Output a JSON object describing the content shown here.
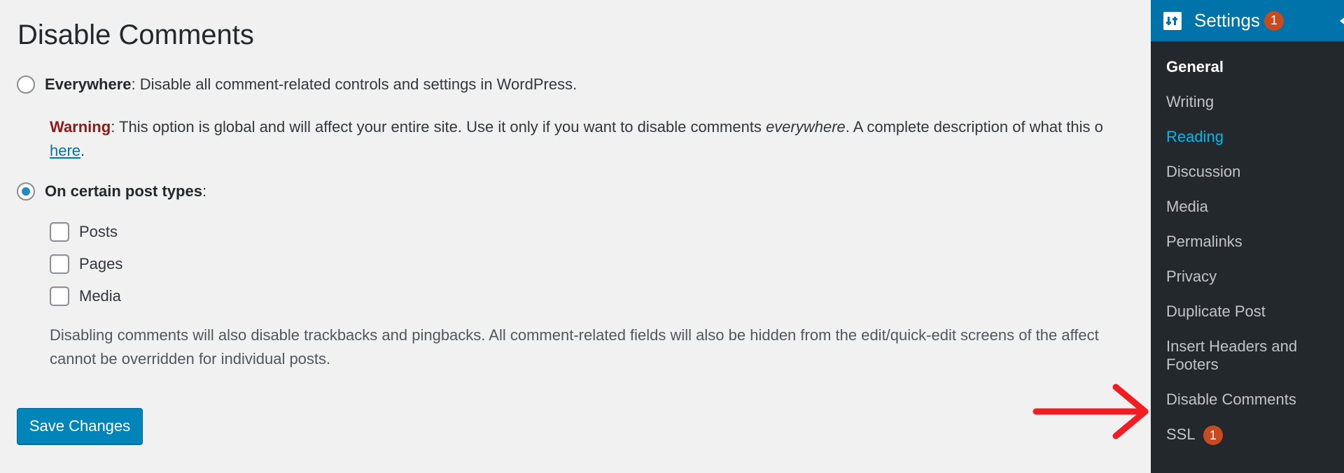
{
  "page": {
    "title": "Disable Comments"
  },
  "options": {
    "everywhere": {
      "label": "Everywhere",
      "description": ": Disable all comment-related controls and settings in WordPress."
    },
    "warning": {
      "label": "Warning",
      "text_before": ": This option is global and will affect your entire site. Use it only if you want to disable comments ",
      "emphasis": "everywhere",
      "text_after": ". A complete description of what this o",
      "link": "here",
      "link_suffix": "."
    },
    "certain": {
      "label": "On certain post types",
      "suffix": ":",
      "selected": true
    },
    "post_types": [
      {
        "label": "Posts",
        "checked": false
      },
      {
        "label": "Pages",
        "checked": false
      },
      {
        "label": "Media",
        "checked": false
      }
    ],
    "note": {
      "line1": "Disabling comments will also disable trackbacks and pingbacks. All comment-related fields will also be hidden from the edit/quick-edit screens of the affect",
      "line2": "cannot be overridden for individual posts."
    }
  },
  "actions": {
    "save_label": "Save Changes"
  },
  "sidebar": {
    "header": {
      "label": "Settings",
      "badge": "1",
      "icon": "settings-icon"
    },
    "items": [
      {
        "label": "General",
        "state": "current"
      },
      {
        "label": "Writing",
        "state": ""
      },
      {
        "label": "Reading",
        "state": "hover"
      },
      {
        "label": "Discussion",
        "state": ""
      },
      {
        "label": "Media",
        "state": ""
      },
      {
        "label": "Permalinks",
        "state": ""
      },
      {
        "label": "Privacy",
        "state": ""
      },
      {
        "label": "Duplicate Post",
        "state": ""
      },
      {
        "label": "Insert Headers and Footers",
        "state": ""
      },
      {
        "label": "Disable Comments",
        "state": ""
      },
      {
        "label": "SSL",
        "state": "",
        "badge": "1"
      }
    ]
  },
  "colors": {
    "accent": "#0073aa",
    "sidebar_bg": "#23282d",
    "badge": "#ca4a1f",
    "warning": "#8b1a1a",
    "annotation_arrow": "#f01e23"
  }
}
